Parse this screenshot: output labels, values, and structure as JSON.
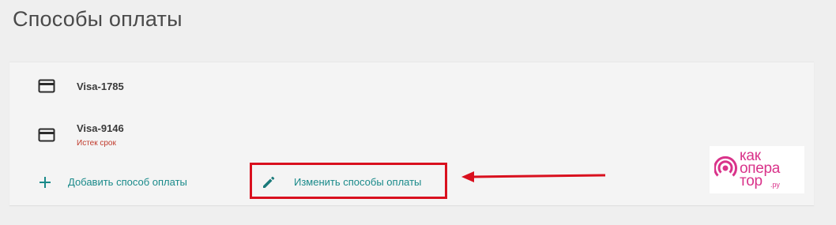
{
  "page": {
    "title": "Способы оплаты"
  },
  "payment_methods": [
    {
      "name": "Visa-1785",
      "status": "",
      "icon": "credit-card-icon"
    },
    {
      "name": "Visa-9146",
      "status": "Истек срок",
      "icon": "credit-card-icon"
    }
  ],
  "actions": {
    "add_label": "Добавить способ оплаты",
    "add_icon": "plus-icon",
    "edit_label": "Изменить способы оплаты",
    "edit_icon": "pencil-icon"
  },
  "annotation": {
    "highlight_color": "#d9101e"
  },
  "watermark": {
    "line1": "как",
    "line2": "опера",
    "line3": "тор",
    "suffix": ".ру",
    "color": "#d9338a"
  },
  "colors": {
    "background": "#efefef",
    "card": "#f4f4f4",
    "link": "#1a8a8a",
    "expired": "#c0392b"
  }
}
